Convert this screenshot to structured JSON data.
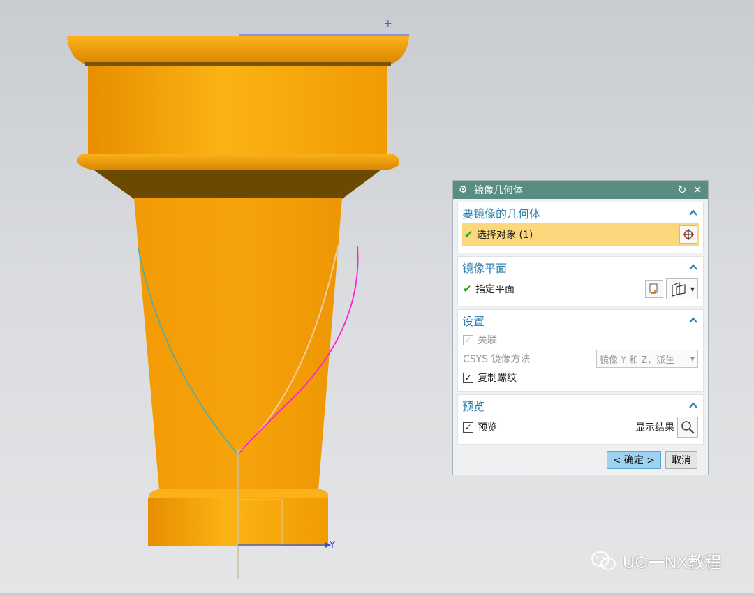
{
  "dialog": {
    "title": "镜像几何体",
    "sections": {
      "geometry": {
        "label": "要镜像的几何体",
        "select_label": "选择对象 (1)"
      },
      "plane": {
        "label": "镜像平面",
        "specify_label": "指定平面"
      },
      "settings": {
        "label": "设置",
        "associative_label": "关联",
        "csys_label": "CSYS 镜像方法",
        "csys_value": "镜像 Y 和 Z，派生",
        "copy_threads_label": "复制螺纹"
      },
      "preview": {
        "label": "预览",
        "preview_label": "预览",
        "show_result_label": "显示结果"
      }
    },
    "buttons": {
      "ok": "< 确定 >",
      "cancel": "取消"
    },
    "checks": {
      "associative": true,
      "copy_threads": true,
      "preview": true
    }
  },
  "viewport": {
    "axis_label": "Y",
    "model_color": "#f5a10a"
  },
  "watermark": {
    "text": "UG一NX教程"
  },
  "colors": {
    "title_bg": "#5a8d82",
    "section_header": "#2f7fb0",
    "selected_row": "#fcd77c",
    "ok_button": "#9fd2f0"
  }
}
